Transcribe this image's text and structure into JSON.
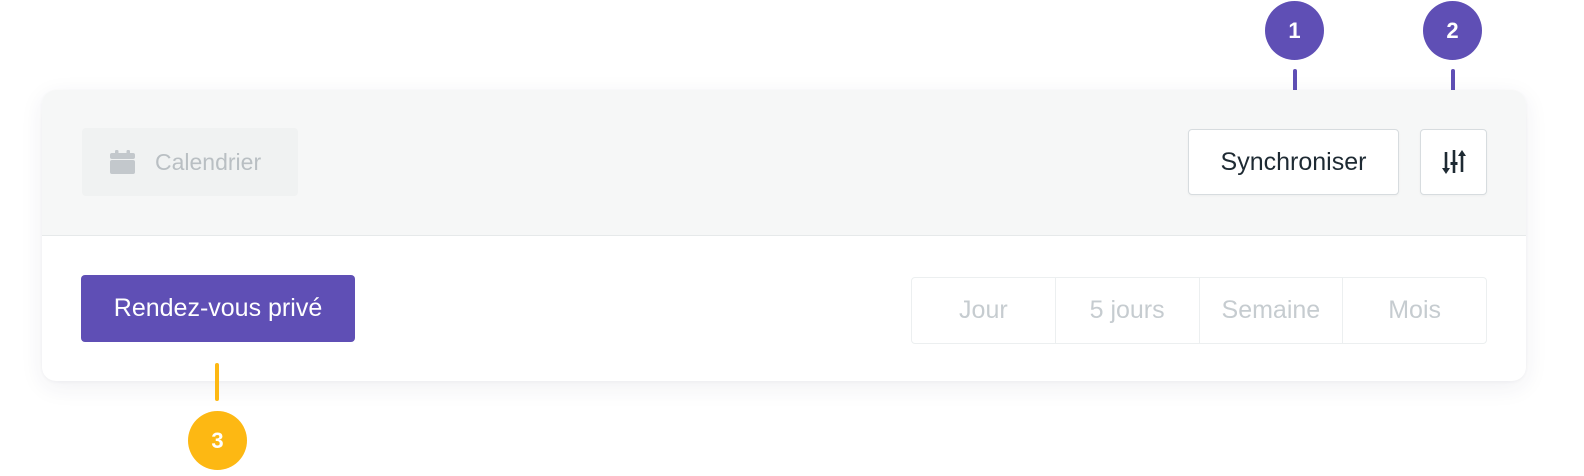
{
  "header": {
    "calendar_label": "Calendrier",
    "sync_label": "Synchroniser"
  },
  "toolbar": {
    "private_appointment_label": "Rendez-vous privé",
    "views": [
      "Jour",
      "5 jours",
      "Semaine",
      "Mois"
    ]
  },
  "annotations": [
    "1",
    "2",
    "3"
  ],
  "icons": {
    "calendar": "calendar-icon",
    "filter": "sliders-sort-icon"
  },
  "colors": {
    "primary": "#5f4fb5",
    "marker_purple": "#5f4fb5",
    "marker_yellow": "#fdb813",
    "header_bg": "#f6f7f7",
    "muted_text": "#c6ccd0"
  }
}
